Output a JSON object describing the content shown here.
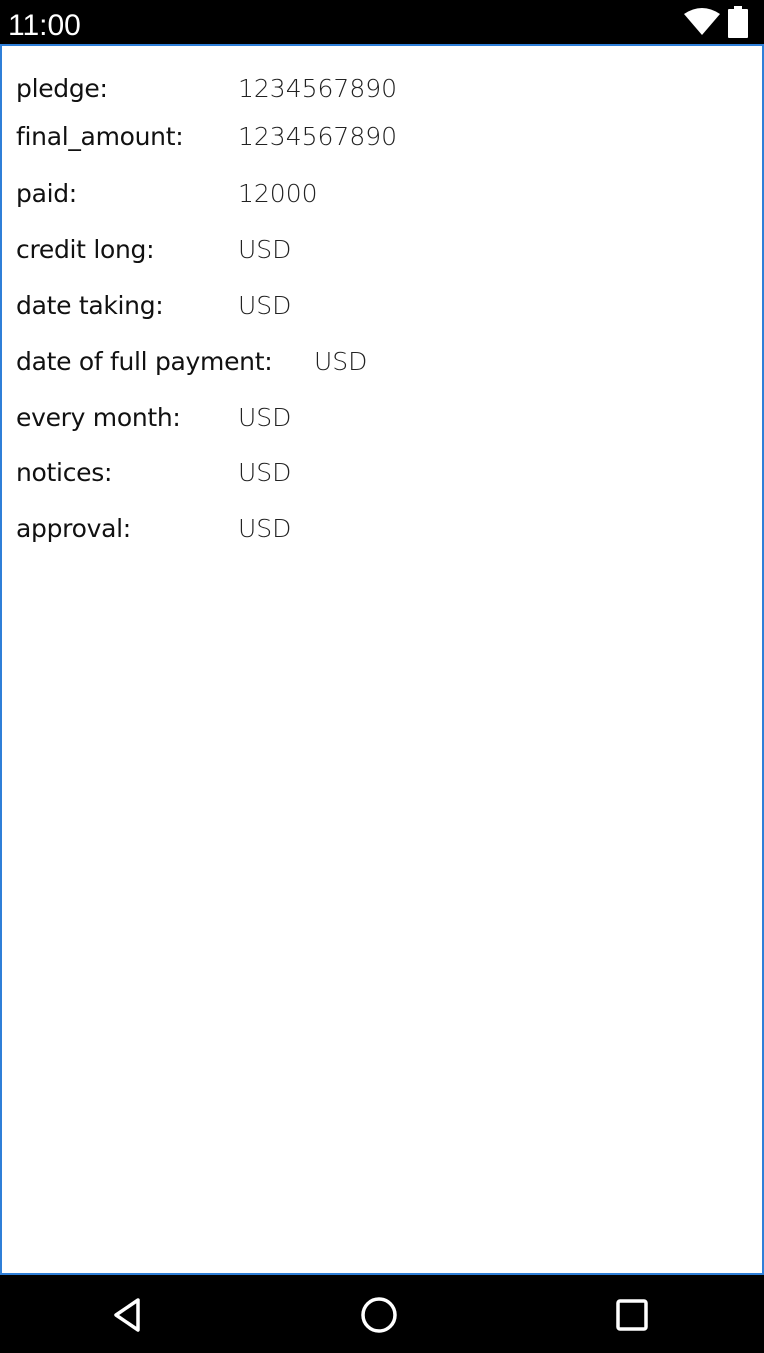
{
  "status_bar": {
    "time": "11:00",
    "icons": [
      "wifi-icon",
      "battery-icon"
    ]
  },
  "details": [
    {
      "label": "pledge:",
      "value": "1234567890"
    },
    {
      "label": "final_amount:",
      "value": "1234567890"
    },
    {
      "label": "paid:",
      "value": "12000"
    },
    {
      "label": "credit long:",
      "value": "USD"
    },
    {
      "label": "date taking:",
      "value": "USD"
    },
    {
      "label": "date of full payment:",
      "value": "USD"
    },
    {
      "label": "every month:",
      "value": "USD"
    },
    {
      "label": "notices:",
      "value": "USD"
    },
    {
      "label": "approval:",
      "value": "USD"
    }
  ],
  "nav_bar": {
    "buttons": [
      "back-icon",
      "home-icon",
      "recents-icon"
    ]
  },
  "colors": {
    "accent_border": "#2f7fd8",
    "background": "#ffffff",
    "bars": "#000000"
  }
}
